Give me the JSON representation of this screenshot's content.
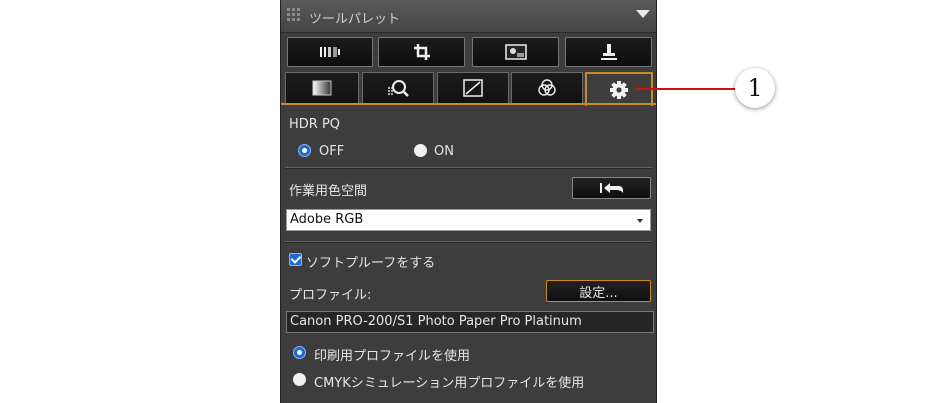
{
  "panel": {
    "title": "ツールパレット"
  },
  "toolbar": {
    "buttons": [
      {
        "icon": "brightness-adjust-icon"
      },
      {
        "icon": "crop-icon"
      },
      {
        "icon": "image-view-icon"
      },
      {
        "icon": "stamp-icon"
      }
    ]
  },
  "tabs": [
    {
      "icon": "tone-gradient-icon"
    },
    {
      "icon": "detail-zoom-icon"
    },
    {
      "icon": "tone-curve-icon"
    },
    {
      "icon": "color-channels-icon"
    },
    {
      "icon": "gear-icon",
      "active": true
    }
  ],
  "hdr": {
    "label": "HDR PQ",
    "off_label": "OFF",
    "on_label": "ON",
    "selected": "OFF"
  },
  "color_space": {
    "label": "作業用色空間",
    "value": "Adobe RGB"
  },
  "soft_proof": {
    "checkbox_label": "ソフトプルーフをする",
    "checked": true,
    "profile_label": "プロファイル:",
    "settings_button": "設定...",
    "profile_value": "Canon PRO-200/S1 Photo Paper Pro Platinum",
    "option_print": "印刷用プロファイルを使用",
    "option_cmyk": "CMYKシミュレーション用プロファイルを使用",
    "selected": "print"
  },
  "callout": {
    "number": "1",
    "color": "#d01010"
  },
  "colors": {
    "accent": "#c98a2a",
    "selection": "#1e6bd6"
  }
}
